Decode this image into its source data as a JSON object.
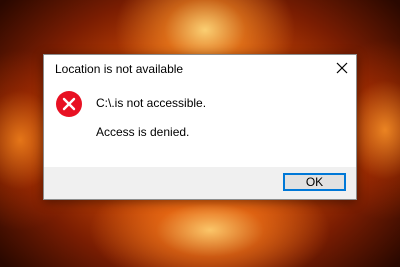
{
  "dialog": {
    "title": "Location is not available",
    "message_primary": "C:\\.is not accessible.",
    "message_secondary": "Access is denied.",
    "ok_label": "OK",
    "icons": {
      "error": "error-icon",
      "close": "close-icon"
    }
  },
  "colors": {
    "error_red": "#e81123",
    "focus_blue": "#0078d7",
    "dialog_bg": "#ffffff",
    "footer_bg": "#f0f0f0"
  }
}
